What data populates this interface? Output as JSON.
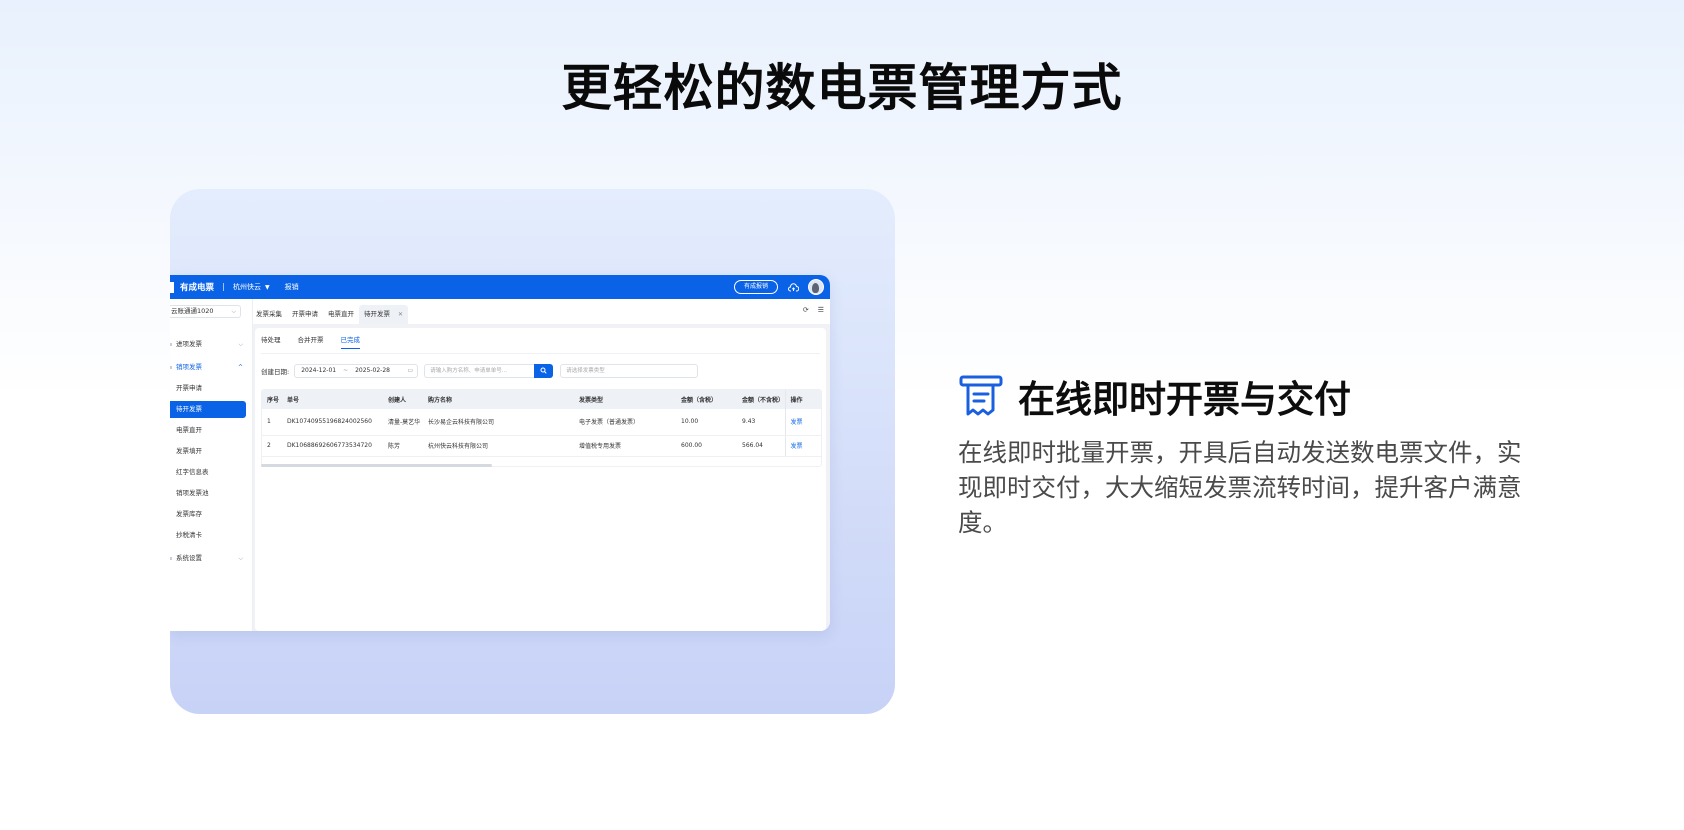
{
  "main_title": "更轻松的数电票管理方式",
  "app": {
    "logo": "有成电票",
    "org": "杭州快云",
    "menu": "报销",
    "account_button": "有成报销",
    "org_select": "云账通通1020",
    "sidebar": [
      {
        "label": "进项发票",
        "type": "group"
      },
      {
        "label": "销项发票",
        "type": "group-open"
      },
      {
        "label": "开票申请",
        "type": "sub"
      },
      {
        "label": "待开发票",
        "type": "active"
      },
      {
        "label": "电票直开",
        "type": "sub"
      },
      {
        "label": "发票填开",
        "type": "sub"
      },
      {
        "label": "红字信息表",
        "type": "sub"
      },
      {
        "label": "销项发票池",
        "type": "sub"
      },
      {
        "label": "发票库存",
        "type": "sub"
      },
      {
        "label": "抄税清卡",
        "type": "sub"
      },
      {
        "label": "系统设置",
        "type": "group"
      }
    ],
    "tabs": [
      "发票采集",
      "开票申请",
      "电票直开",
      "待开发票"
    ],
    "subtabs": [
      "待处理",
      "合并开票",
      "已完成"
    ],
    "filters": {
      "date_label": "创建日期:",
      "date_start": "2024-12-01",
      "date_end": "2025-02-28",
      "search_placeholder": "请输入购方名称、申请单单号...",
      "type_placeholder": "请选择发票类型"
    },
    "table": {
      "headers": [
        "序号",
        "单号",
        "创建人",
        "购方名称",
        "发票类型",
        "金额（含税）",
        "金额（不含税）",
        "操作"
      ],
      "rows": [
        [
          "1",
          "DK10740955196824002560",
          "清量-莫艺华",
          "长沙易企云科技有限公司",
          "电子发票（普通发票）",
          "10.00",
          "9.43",
          "发票"
        ],
        [
          "2",
          "DK10688692606773534720",
          "陈芳",
          "杭州快云科技有限公司",
          "增值税专用发票",
          "600.00",
          "566.04",
          "发票"
        ]
      ]
    }
  },
  "feature": {
    "title": "在线即时开票与交付",
    "description": "在线即时批量开票，开具后自动发送数电票文件，实现即时交付，大大缩短发票流转时间，提升客户满意度。"
  },
  "colors": {
    "accent": "#0a63e6"
  }
}
